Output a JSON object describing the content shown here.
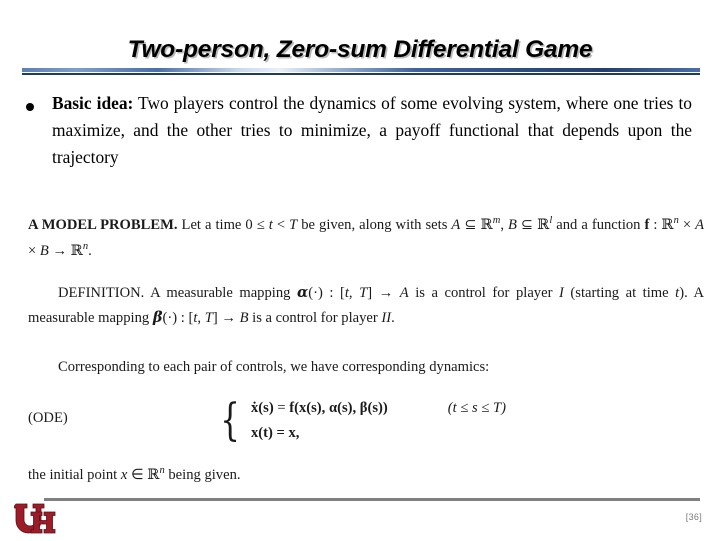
{
  "slide": {
    "title": "Two-person, Zero-sum Differential Game",
    "page_number": "[36]",
    "accent_color": "#2f4f85",
    "footer_rule_color": "#808080",
    "logo_color": "#9c1c28",
    "logo_name": "university-of-houston-logo"
  },
  "bullet": {
    "marker": "●",
    "lead": "Basic idea:",
    "line1": "Two players control the dynamics of some",
    "line2": "evolving system, where one tries to maximize, and the other",
    "line3": "tries to minimize, a payoff functional that depends upon the",
    "line4": "trajectory"
  },
  "math": {
    "model_problem": {
      "heading": "A MODEL PROBLEM.",
      "line1_a": " Let a time 0 ≤ ",
      "line1_t": "t",
      "line1_b": " < ",
      "line1_T": "T",
      "line1_c": " be given, along with sets ",
      "line1_A": "A",
      "line1_d": " ⊆ ",
      "line1_Rm": "ℝ",
      "line1_m": "m",
      "line1_e": ",",
      "line2_B": "B",
      "line2_a": " ⊆ ",
      "line2_Rl": "ℝ",
      "line2_l": "l",
      "line2_b": " and a function ",
      "line2_f": "f",
      "line2_c": " : ",
      "line2_Rn": "ℝ",
      "line2_n": "n",
      "line2_d": " × ",
      "line2_A": "A",
      "line2_e": " × ",
      "line2_B2": "B",
      "line2_f2": " → ",
      "line2_Rn2": "ℝ",
      "line2_n2": "n",
      "line2_g": "."
    },
    "definition": {
      "heading": "DEFINITION.",
      "a": " A measurable mapping ",
      "alpha": "α",
      "b": "(·) : [",
      "t": "t",
      "c": ", ",
      "T": "T",
      "d": "] → ",
      "A": "A",
      "e": " is a control for player ",
      "I": "I",
      "f": " (starting at time ",
      "t2": "t",
      "g": "). A measurable mapping ",
      "beta": "β",
      "h": "(·) : [",
      "t3": "t",
      "i": ", ",
      "T2": "T",
      "j": "] → ",
      "B": "B",
      "k": " is a control for player ",
      "II": "II",
      "l": "."
    },
    "corresponding": "Corresponding to each pair of controls, we have corresponding dynamics:",
    "ode": {
      "tag": "(ODE)",
      "line1_lhs": "ẋ(s)",
      "line1_eq": " = ",
      "line1_f": "f",
      "line1_args": "(x(s), α(s), β(s))",
      "line1_cond": "(t ≤ s ≤ T)",
      "line2": "x(t) = x,"
    },
    "initial": {
      "a": "the initial point ",
      "x": "x",
      "b": " ∈ ",
      "R": "ℝ",
      "n": "n",
      "c": " being given."
    }
  }
}
